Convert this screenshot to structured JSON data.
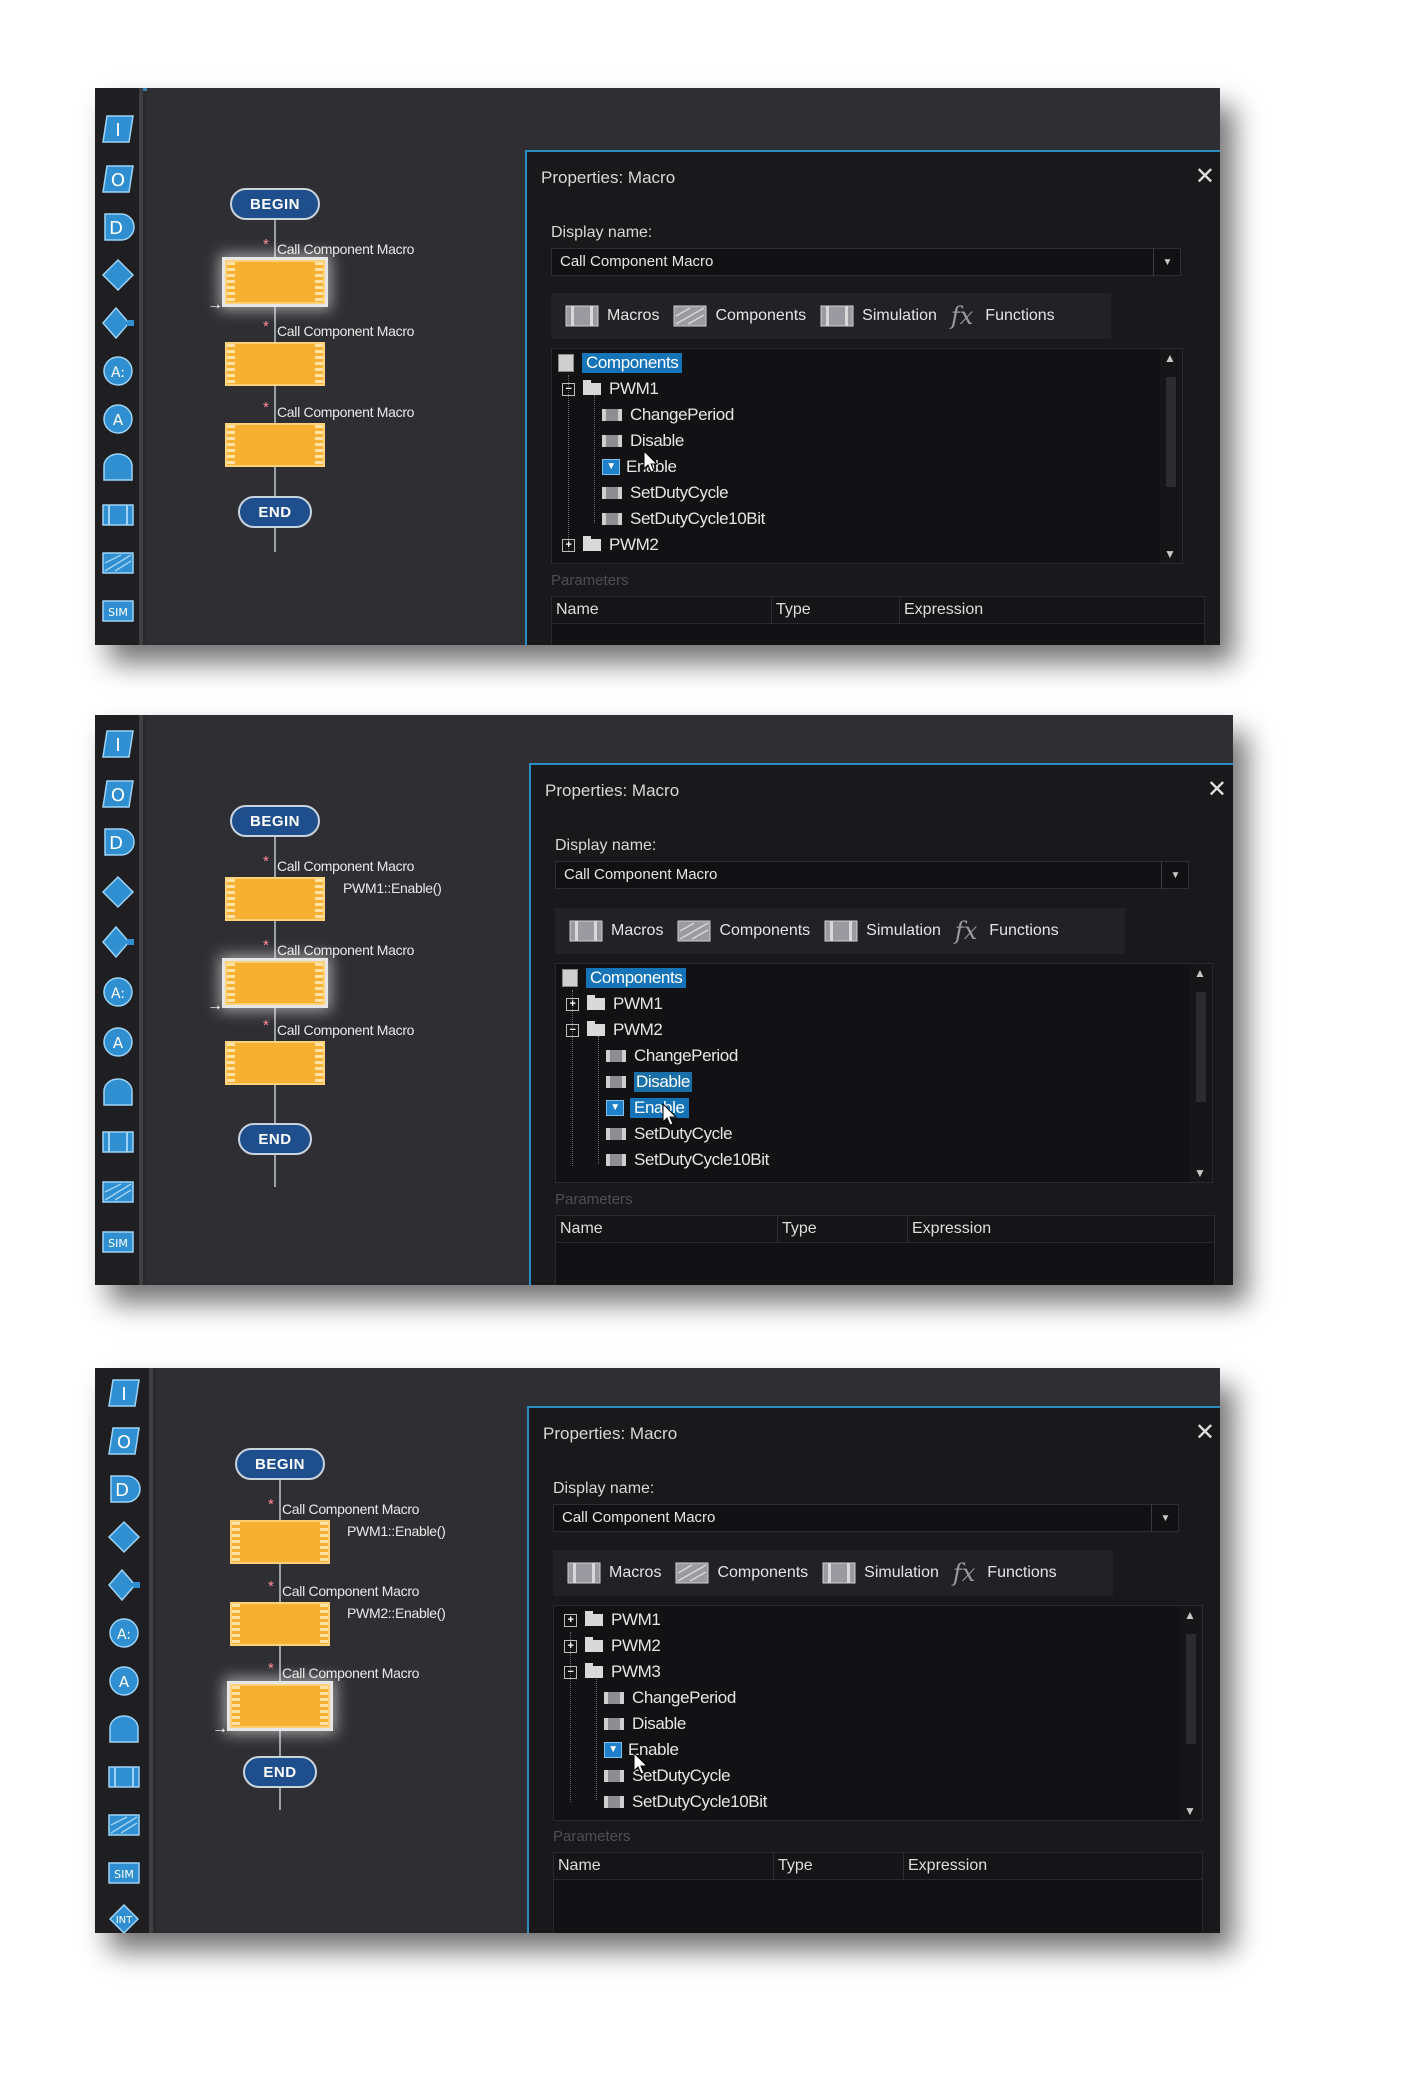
{
  "toolbar_icons": [
    "input-icon",
    "output-icon",
    "delay-icon",
    "decision-icon",
    "switch-icon",
    "calculation-icon",
    "connection-point-icon",
    "loop-icon",
    "macro-icon",
    "component-macro-icon",
    "simulation-icon",
    "interrupt-icon"
  ],
  "toolbar_text": {
    "input": "I",
    "output": "O",
    "delay": "D",
    "calc": "A:",
    "connect": "A",
    "sim": "SIM",
    "interrupt": "INT"
  },
  "flowchart": {
    "begin": "BEGIN",
    "end": "END",
    "call_label": "Call Component Macro",
    "sub_pwm1": "PWM1::Enable()",
    "sub_pwm2": "PWM2::Enable()",
    "star": "*",
    "arrow": "→"
  },
  "dialog": {
    "title": "Properties: Macro",
    "close": "✕",
    "display_name_label": "Display name:",
    "display_name_value": "Call Component Macro",
    "dropdown": "▼",
    "tabs": {
      "macros": "Macros",
      "components": "Components",
      "simulation": "Simulation",
      "functions": "Functions",
      "fx": "fx"
    },
    "parameters_label": "Parameters",
    "columns": {
      "name": "Name",
      "type": "Type",
      "expression": "Expression"
    }
  },
  "tree": {
    "components": "Components",
    "pwm1": "PWM1",
    "pwm2": "PWM2",
    "pwm3": "PWM3",
    "change_period": "ChangePeriod",
    "disable": "Disable",
    "enable": "Enable",
    "set_duty": "SetDutyCycle",
    "set_duty10": "SetDutyCycle10Bit",
    "plus": "+",
    "minus": "−",
    "check": "▼"
  },
  "colors": {
    "accent": "#2b8cc4",
    "selection": "#1574b8",
    "flow_box": "#f7b032",
    "terminal": "#1e4f8c"
  }
}
